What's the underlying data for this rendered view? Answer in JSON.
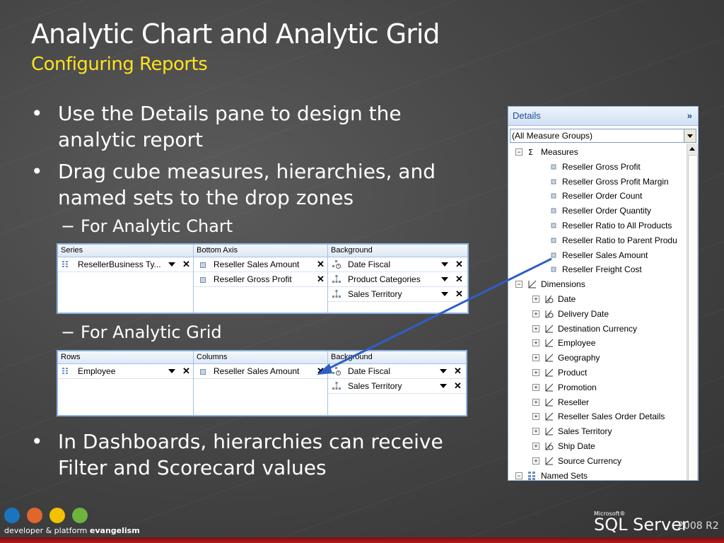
{
  "slide": {
    "title": "Analytic Chart and Analytic Grid",
    "subtitle": "Configuring Reports",
    "bullets": [
      {
        "text": "Use the Details pane to design the\nanalytic report"
      },
      {
        "text": "Drag cube measures, hierarchies, and\nnamed sets to the drop zones"
      },
      {
        "text": "In Dashboards, hierarchies can receive\nFilter and Scorecard values"
      }
    ],
    "bullet_char": "•",
    "dash_char": "−",
    "subbullets": [
      "For Analytic Chart",
      "For Analytic Grid"
    ]
  },
  "chart_zone": {
    "columns": [
      {
        "header": "Series",
        "items": [
          {
            "label": "ResellerBusiness Ty...",
            "icon": "named-set-icon",
            "dropdown": true
          }
        ]
      },
      {
        "header": "Bottom Axis",
        "items": [
          {
            "label": "Reseller Sales Amount",
            "icon": "measure-icon",
            "dropdown": false
          },
          {
            "label": "Reseller Gross Profit",
            "icon": "measure-icon",
            "dropdown": false
          }
        ]
      },
      {
        "header": "Background",
        "items": [
          {
            "label": "Date Fiscal",
            "icon": "time-hierarchy-icon",
            "dropdown": true
          },
          {
            "label": "Product Categories",
            "icon": "hierarchy-icon",
            "dropdown": true
          },
          {
            "label": "Sales Territory",
            "icon": "hierarchy-icon",
            "dropdown": true
          }
        ]
      }
    ]
  },
  "grid_zone": {
    "columns": [
      {
        "header": "Rows",
        "items": [
          {
            "label": "Employee",
            "icon": "named-set-icon",
            "dropdown": true
          }
        ]
      },
      {
        "header": "Columns",
        "items": [
          {
            "label": "Reseller Sales Amount",
            "icon": "measure-icon",
            "dropdown": false
          }
        ]
      },
      {
        "header": "Background",
        "items": [
          {
            "label": "Date Fiscal",
            "icon": "time-hierarchy-icon",
            "dropdown": true
          },
          {
            "label": "Sales Territory",
            "icon": "hierarchy-icon",
            "dropdown": true
          }
        ]
      }
    ]
  },
  "details_pane": {
    "title": "Details",
    "collapse_glyph": "»",
    "measure_group": "(All Measure Groups)",
    "measures_label": "Measures",
    "measures": [
      "Reseller Gross Profit",
      "Reseller Gross Profit Margin",
      "Reseller Order Count",
      "Reseller Order Quantity",
      "Reseller Ratio to All Products",
      "Reseller Ratio to Parent Produ",
      "Reseller Sales Amount",
      "Reseller Freight Cost"
    ],
    "dimensions_label": "Dimensions",
    "dimensions": [
      {
        "label": "Date",
        "icon": "time-dimension-icon"
      },
      {
        "label": "Delivery Date",
        "icon": "time-dimension-icon"
      },
      {
        "label": "Destination Currency",
        "icon": "dimension-icon"
      },
      {
        "label": "Employee",
        "icon": "dimension-icon"
      },
      {
        "label": "Geography",
        "icon": "dimension-icon"
      },
      {
        "label": "Product",
        "icon": "dimension-icon"
      },
      {
        "label": "Promotion",
        "icon": "dimension-icon"
      },
      {
        "label": "Reseller",
        "icon": "dimension-icon"
      },
      {
        "label": "Reseller Sales Order Details",
        "icon": "dimension-icon"
      },
      {
        "label": "Sales Territory",
        "icon": "dimension-icon"
      },
      {
        "label": "Ship Date",
        "icon": "time-dimension-icon"
      },
      {
        "label": "Source Currency",
        "icon": "dimension-icon"
      }
    ],
    "named_sets_label": "Named Sets"
  },
  "footer": {
    "tagline_a": "developer & platform",
    "tagline_b": "evangelism",
    "ms_label": "Microsoft®",
    "product": "SQL Server",
    "version": "2008 R2"
  },
  "colors": {
    "title": "#ffffff",
    "subtitle": "#ffe21f",
    "accent_blue": "#1d4f9c",
    "arrow": "#2f5ec4",
    "footer_bar": "#b31b1b"
  }
}
